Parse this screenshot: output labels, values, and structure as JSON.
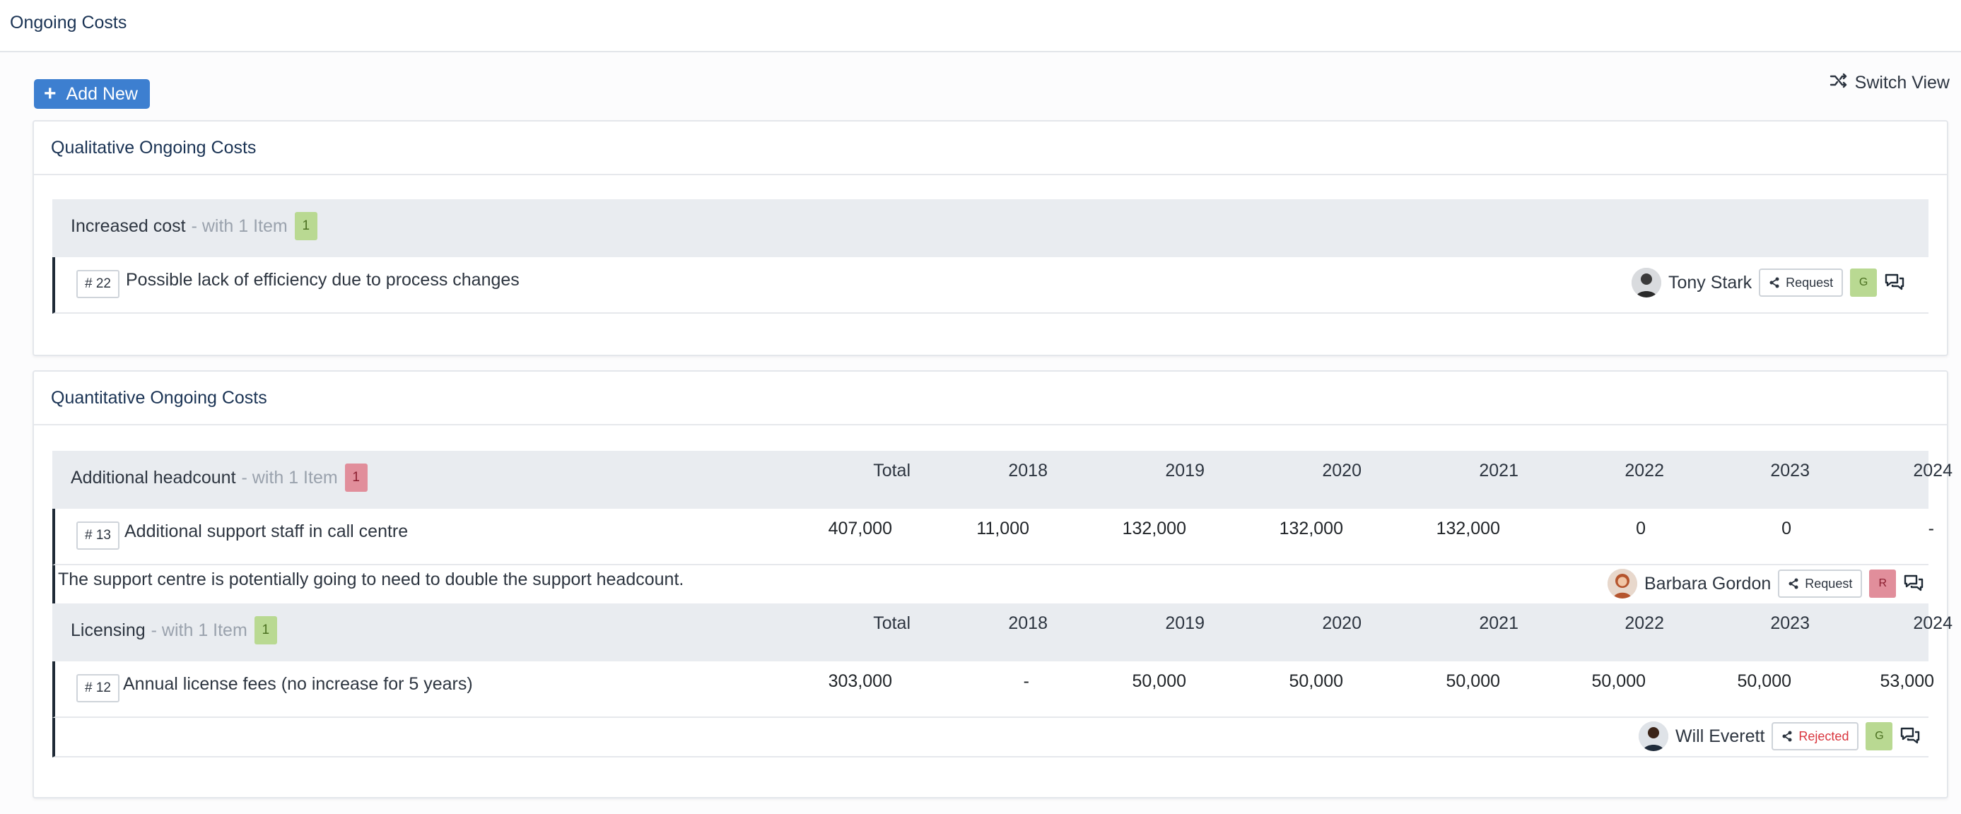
{
  "page": {
    "title": "Ongoing Costs"
  },
  "toolbar": {
    "add_label": "Add New",
    "switch_view_label": "Switch View"
  },
  "colors": {
    "accent": "#3d7fd0",
    "green": "#b9d992",
    "red": "#e18e9b",
    "rejected": "#d9363e"
  },
  "qualitative": {
    "title": "Qualitative Ongoing Costs",
    "groups": [
      {
        "name": "Increased cost",
        "with_text": "- with 1 Item",
        "count": "1",
        "items": [
          {
            "id": "# 22",
            "title": "Possible lack of efficiency due to process changes",
            "owner": "Tony Stark",
            "action": "Request",
            "rag": "G"
          }
        ]
      }
    ]
  },
  "quantitative": {
    "title": "Quantitative Ongoing Costs",
    "columns": [
      "Total",
      "2018",
      "2019",
      "2020",
      "2021",
      "2022",
      "2023",
      "2024"
    ],
    "groups": [
      {
        "name": "Additional headcount",
        "with_text": "- with 1 Item",
        "count": "1",
        "items": [
          {
            "id": "# 13",
            "title": "Additional support staff in call centre",
            "values": [
              "407,000",
              "11,000",
              "132,000",
              "132,000",
              "132,000",
              "0",
              "0",
              "-"
            ],
            "description": "The support centre is potentially going to need to double the support headcount.",
            "owner": "Barbara Gordon",
            "action": "Request",
            "rag": "R"
          }
        ]
      },
      {
        "name": "Licensing",
        "with_text": "- with 1 Item",
        "count": "1",
        "items": [
          {
            "id": "# 12",
            "title": "Annual license fees (no increase for 5 years)",
            "values": [
              "303,000",
              "-",
              "50,000",
              "50,000",
              "50,000",
              "50,000",
              "50,000",
              "53,000"
            ],
            "description": "",
            "owner": "Will Everett",
            "action": "Rejected",
            "rag": "G"
          }
        ]
      }
    ]
  },
  "icons": {
    "add": "plus-icon",
    "switch_view": "shuffle-icon",
    "share": "share-icon",
    "comments": "comments-icon"
  }
}
